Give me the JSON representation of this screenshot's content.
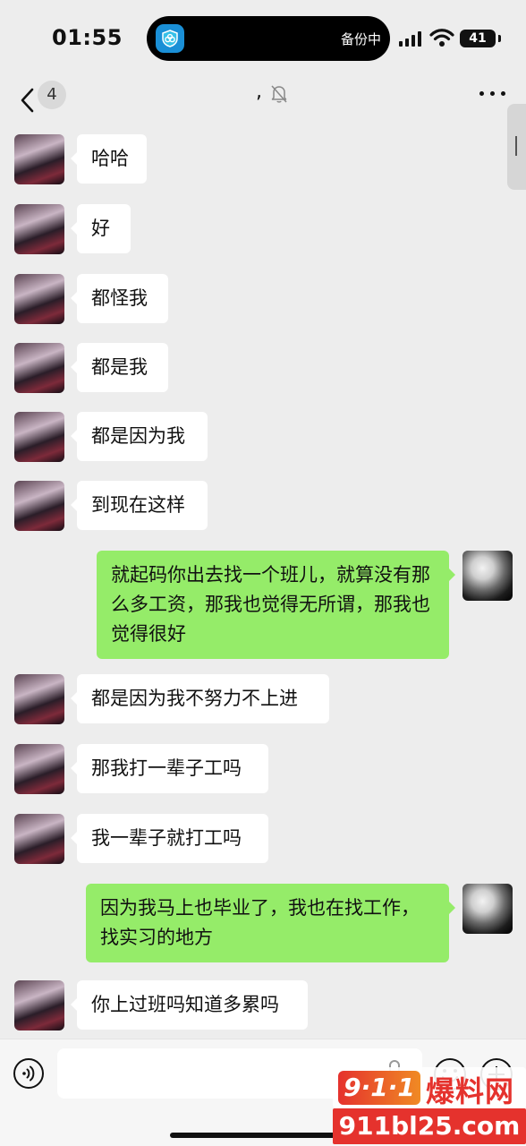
{
  "status_bar": {
    "time": "01:55",
    "island_label": "备份中",
    "battery": "41",
    "island_app_icon": "shield-cloud-icon"
  },
  "nav": {
    "unread_count": "4",
    "title": ",",
    "mute_icon": "muted-bell-icon"
  },
  "messages": [
    {
      "side": "left",
      "text": "哈哈"
    },
    {
      "side": "left",
      "text": "好"
    },
    {
      "side": "left",
      "text": "都怪我"
    },
    {
      "side": "left",
      "text": "都是我"
    },
    {
      "side": "left",
      "text": "都是因为我"
    },
    {
      "side": "left",
      "text": "到现在这样"
    },
    {
      "side": "right",
      "text": "就起码你出去找一个班儿，就算没有那么多工资，那我也觉得无所谓，那我也觉得很好"
    },
    {
      "side": "left",
      "text": "都是因为我不努力不上进"
    },
    {
      "side": "left",
      "text": "那我打一辈子工吗"
    },
    {
      "side": "left",
      "text": "我一辈子就打工吗"
    },
    {
      "side": "right",
      "text": "因为我马上也毕业了，我也在找工作，找实习的地方"
    },
    {
      "side": "left",
      "text": "你上过班吗知道多累吗"
    }
  ],
  "input_bar": {
    "text_value": "",
    "voice_icon": "voice-icon",
    "emoji_icon": "emoji-icon",
    "plus_icon": "plus-icon"
  },
  "watermark": {
    "badge": "9·1·1",
    "name": "爆料网",
    "url": "911bl25.com"
  },
  "colors": {
    "background": "#ededed",
    "bubble_left": "#ffffff",
    "bubble_right": "#95ec69",
    "watermark_red": "#e5322d"
  }
}
